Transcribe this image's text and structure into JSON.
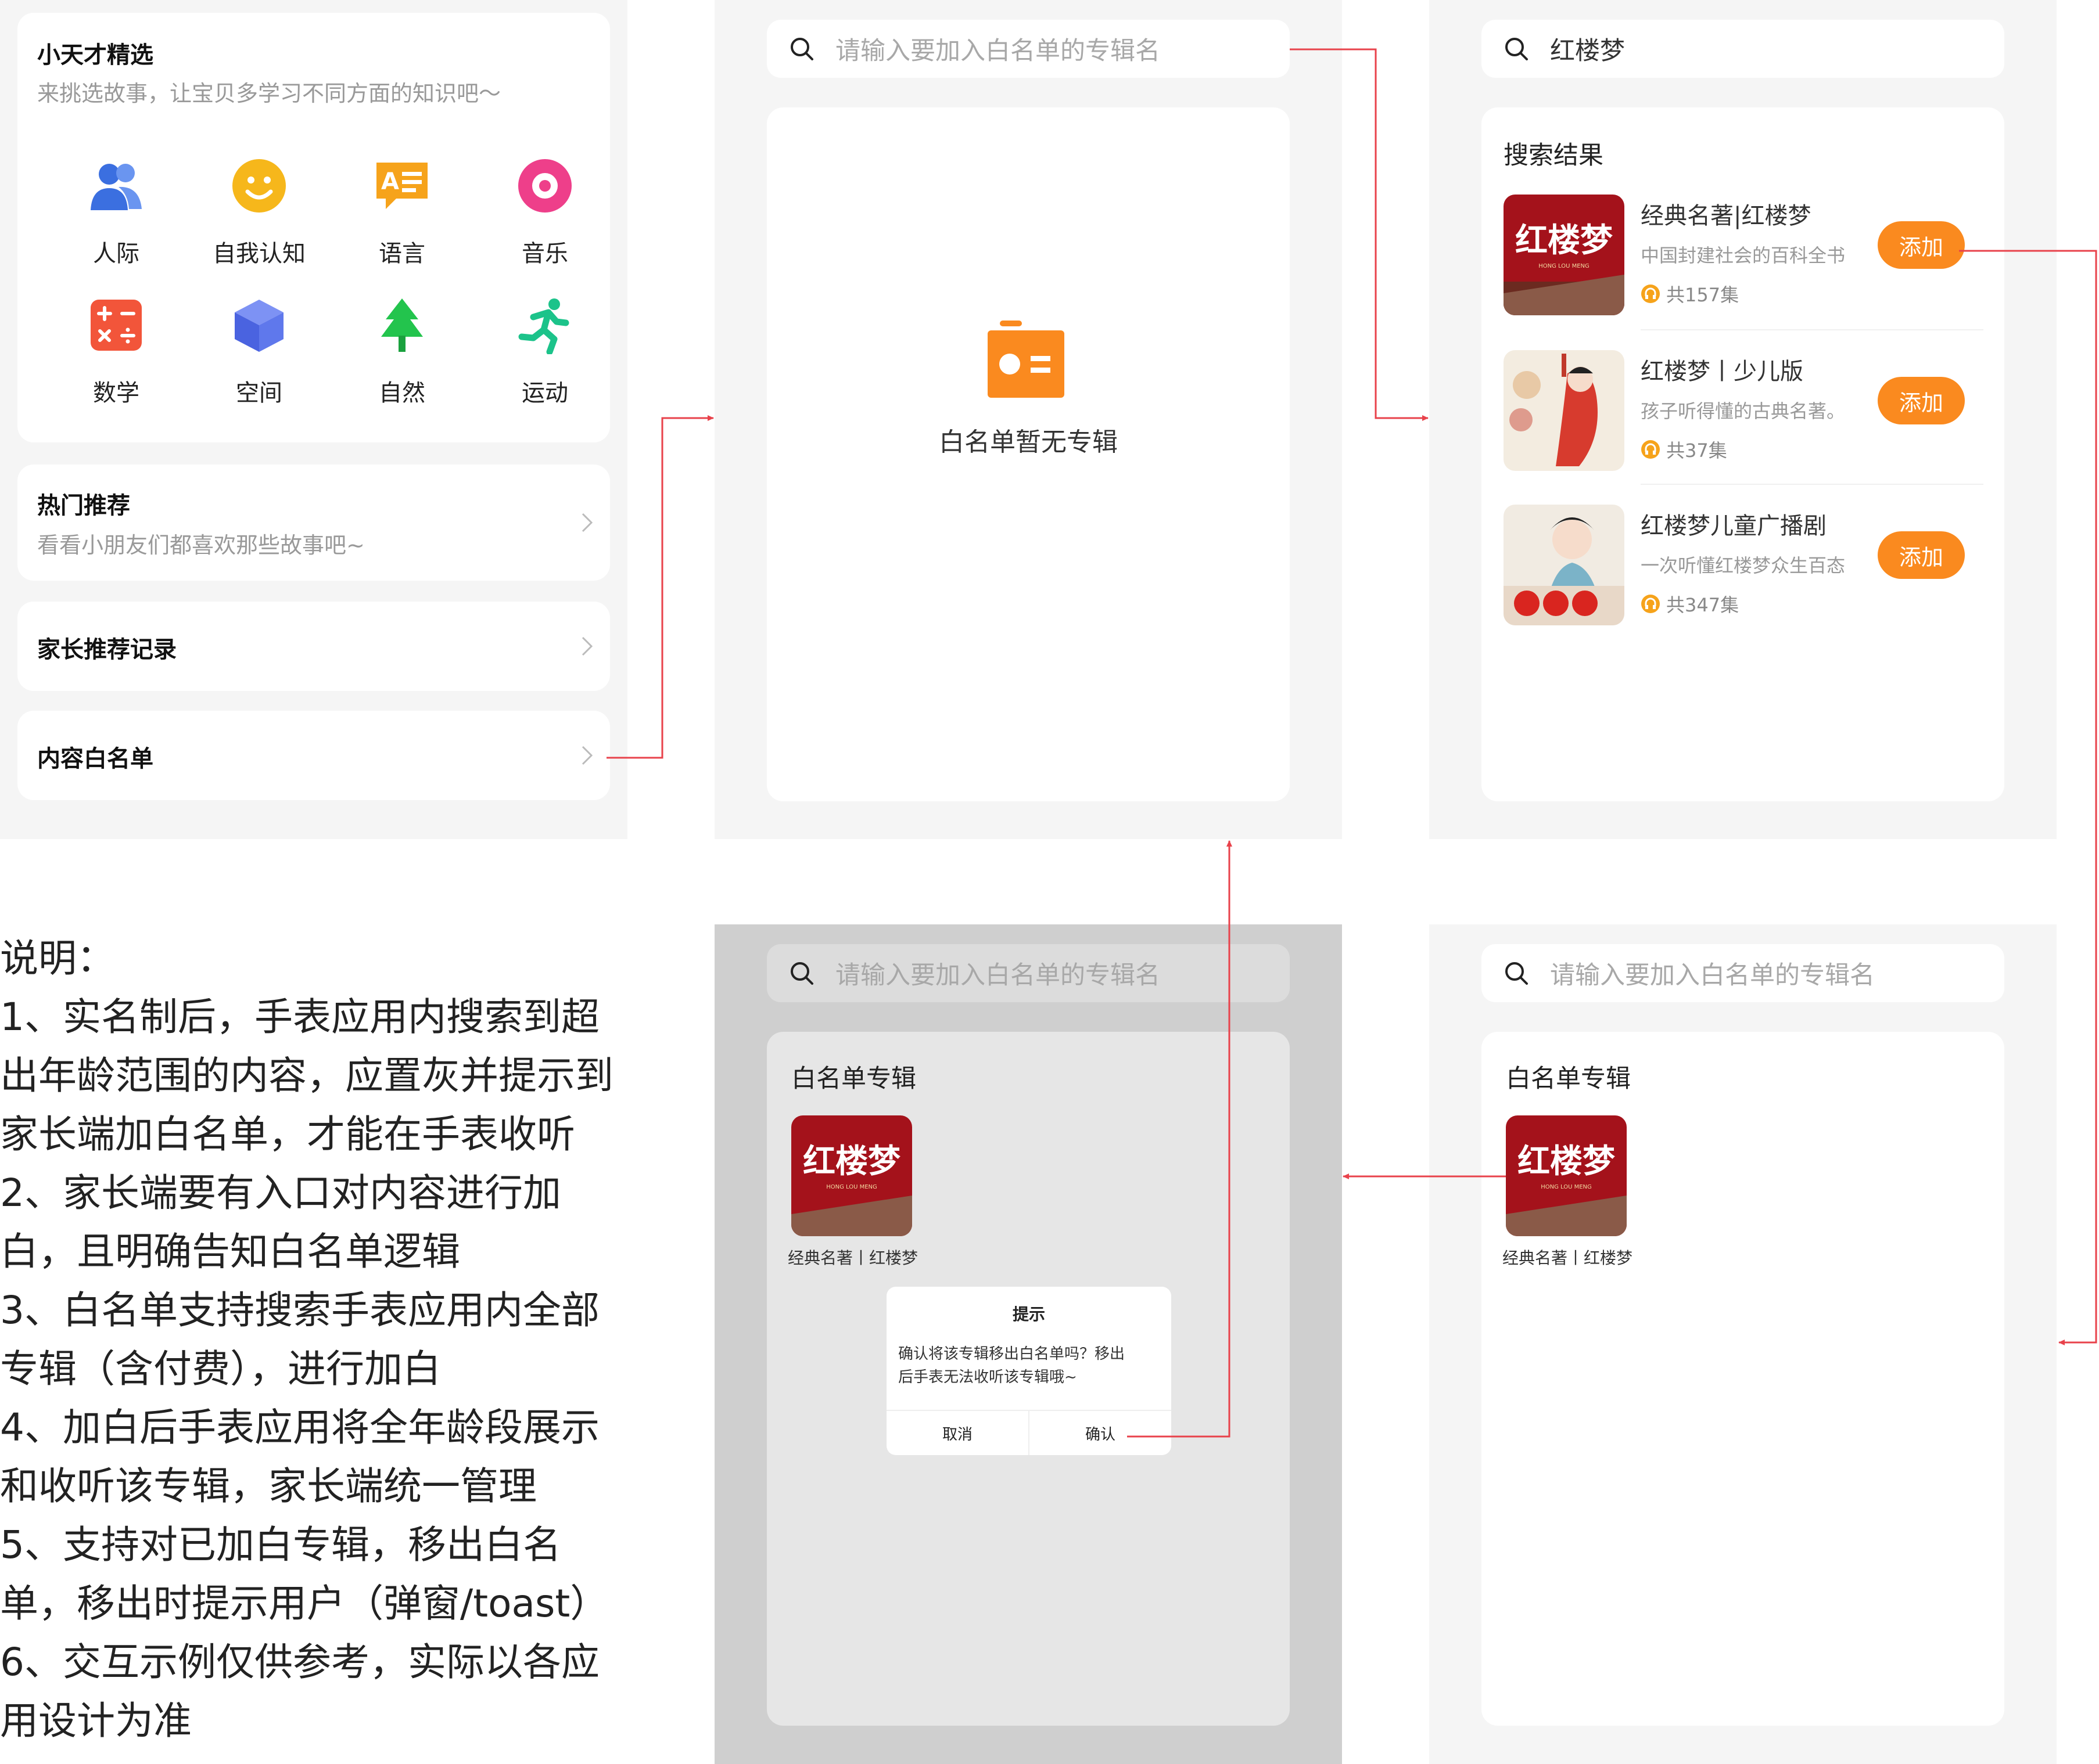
{
  "home": {
    "picks_title": "小天才精选",
    "picks_sub": "来挑选故事，让宝贝多学习不同方面的知识吧～",
    "categories": [
      {
        "label": "人际",
        "icon": "people-icon",
        "color": "#3b6fe0"
      },
      {
        "label": "自我认知",
        "icon": "smiley-icon",
        "color": "#f6b71b"
      },
      {
        "label": "语言",
        "icon": "language-icon",
        "color": "#f6a31b"
      },
      {
        "label": "音乐",
        "icon": "music-disc-icon",
        "color": "#ee3f8a"
      },
      {
        "label": "数学",
        "icon": "math-icon",
        "color": "#f2553a"
      },
      {
        "label": "空间",
        "icon": "cube-icon",
        "color": "#5b73ea"
      },
      {
        "label": "自然",
        "icon": "tree-icon",
        "color": "#23c44d"
      },
      {
        "label": "运动",
        "icon": "running-icon",
        "color": "#1cc38a"
      }
    ],
    "hot_title": "热门推荐",
    "hot_sub": "看看小朋友们都喜欢那些故事吧~",
    "parent_rec": "家长推荐记录",
    "whitelist": "内容白名单"
  },
  "empty_screen": {
    "search_placeholder": "请输入要加入白名单的专辑名",
    "empty_text": "白名单暂无专辑"
  },
  "search_screen": {
    "query": "红楼梦",
    "results_title": "搜索结果",
    "add_label": "添加",
    "results": [
      {
        "name": "经典名著|红楼梦",
        "desc": "中国封建社会的百科全书",
        "count": "共157集"
      },
      {
        "name": "红楼梦丨少儿版",
        "desc": "孩子听得懂的古典名著。",
        "count": "共37集"
      },
      {
        "name": "红楼梦儿童广播剧",
        "desc": "一次听懂红楼梦众生百态",
        "count": "共347集"
      }
    ]
  },
  "whitelist_screen": {
    "search_placeholder": "请输入要加入白名单的专辑名",
    "section_title": "白名单专辑",
    "album_caption": "经典名著丨红楼梦"
  },
  "remove_screen": {
    "search_placeholder": "请输入要加入白名单的专辑名",
    "section_title": "白名单专辑",
    "album_caption": "经典名著丨红楼梦",
    "dialog": {
      "title": "提示",
      "message_line1": "确认将该专辑移出白名单吗？移出",
      "message_line2": "后手表无法收听该专辑哦~",
      "cancel": "取消",
      "confirm": "确认"
    }
  },
  "cover_art": {
    "title_glyphs": "红楼梦",
    "romanization": "HONG LOU MENG"
  },
  "notes": [
    "说明：",
    "1、实名制后，手表应用内搜索到超",
    "出年龄范围的内容，应置灰并提示到",
    "家长端加白名单，才能在手表收听",
    "2、家长端要有入口对内容进行加",
    "白，且明确告知白名单逻辑",
    "3、白名单支持搜索手表应用内全部",
    "专辑（含付费），进行加白",
    "4、加白后手表应用将全年龄段展示",
    "和收听该专辑，家长端统一管理",
    "5、支持对已加白专辑，移出白名",
    "单，移出时提示用户（弹窗/toast）",
    "6、交互示例仅供参考，实际以各应",
    "用设计为准"
  ],
  "colors": {
    "accent": "#fa8a1f",
    "arrow": "#e8424b",
    "panel": "#f5f5f5",
    "overlay": "#cfcfcf"
  }
}
